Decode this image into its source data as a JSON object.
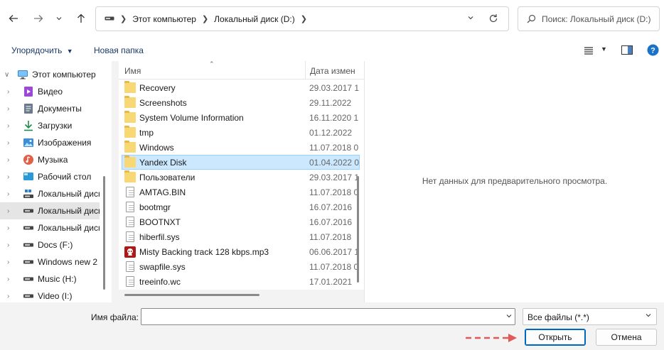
{
  "navigation": {
    "back_icon": "arrow-left-icon",
    "forward_icon": "arrow-right-icon",
    "recent_icon": "chevron-down-icon",
    "up_icon": "arrow-up-icon"
  },
  "address_bar": {
    "segments": [
      "Этот компьютер",
      "Локальный диск (D:)"
    ]
  },
  "search": {
    "placeholder": "Поиск: Локальный диск (D:)"
  },
  "toolbar": {
    "organize_label": "Упорядочить",
    "new_folder_label": "Новая папка"
  },
  "sidebar": {
    "items": [
      {
        "label": "Этот компьютер",
        "icon": "pc-icon",
        "expanded": true
      },
      {
        "label": "Видео",
        "icon": "video-icon"
      },
      {
        "label": "Документы",
        "icon": "documents-icon"
      },
      {
        "label": "Загрузки",
        "icon": "downloads-icon"
      },
      {
        "label": "Изображения",
        "icon": "pictures-icon"
      },
      {
        "label": "Музыка",
        "icon": "music-icon"
      },
      {
        "label": "Рабочий стол",
        "icon": "desktop-icon"
      },
      {
        "label": "Локальный диск",
        "icon": "system-drive-icon"
      },
      {
        "label": "Локальный диск",
        "icon": "drive-icon",
        "selected": true
      },
      {
        "label": "Локальный диск",
        "icon": "drive-icon"
      },
      {
        "label": "Docs (F:)",
        "icon": "drive-icon"
      },
      {
        "label": "Windows new 2",
        "icon": "drive-icon"
      },
      {
        "label": "Music (H:)",
        "icon": "drive-icon"
      },
      {
        "label": "Video (I:)",
        "icon": "drive-icon"
      }
    ]
  },
  "file_list": {
    "columns": [
      "Имя",
      "Дата измен"
    ],
    "rows": [
      {
        "name": "Recovery",
        "date": "29.03.2017 1",
        "type": "folder"
      },
      {
        "name": "Screenshots",
        "date": "29.11.2022",
        "type": "folder"
      },
      {
        "name": "System Volume Information",
        "date": "16.11.2020 1",
        "type": "folder"
      },
      {
        "name": "tmp",
        "date": "01.12.2022",
        "type": "folder"
      },
      {
        "name": "Windows",
        "date": "11.07.2018 0",
        "type": "folder"
      },
      {
        "name": "Yandex Disk",
        "date": "01.04.2022 0",
        "type": "folder",
        "selected": true
      },
      {
        "name": "Пользователи",
        "date": "29.03.2017 1",
        "type": "folder"
      },
      {
        "name": "AMTAG.BIN",
        "date": "11.07.2018 0",
        "type": "file"
      },
      {
        "name": "bootmgr",
        "date": "16.07.2016",
        "type": "file"
      },
      {
        "name": "BOOTNXT",
        "date": "16.07.2016",
        "type": "file"
      },
      {
        "name": "hiberfil.sys",
        "date": "11.07.2018",
        "type": "file"
      },
      {
        "name": "Misty  Backing track 128 kbps.mp3",
        "date": "06.06.2017 1",
        "type": "audio"
      },
      {
        "name": "swapfile.sys",
        "date": "11.07.2018 0",
        "type": "file"
      },
      {
        "name": "treeinfo.wc",
        "date": "17.01.2021",
        "type": "file"
      }
    ]
  },
  "preview": {
    "message": "Нет данных для предварительного просмотра."
  },
  "footer": {
    "filename_label": "Имя файла:",
    "filename_value": "",
    "filter_value": "Все файлы (*.*)",
    "open_label": "Открыть",
    "cancel_label": "Отмена"
  },
  "colors": {
    "accent": "#0067c0",
    "selection": "#cce8ff",
    "annotation_arrow": "#e05a5a"
  }
}
